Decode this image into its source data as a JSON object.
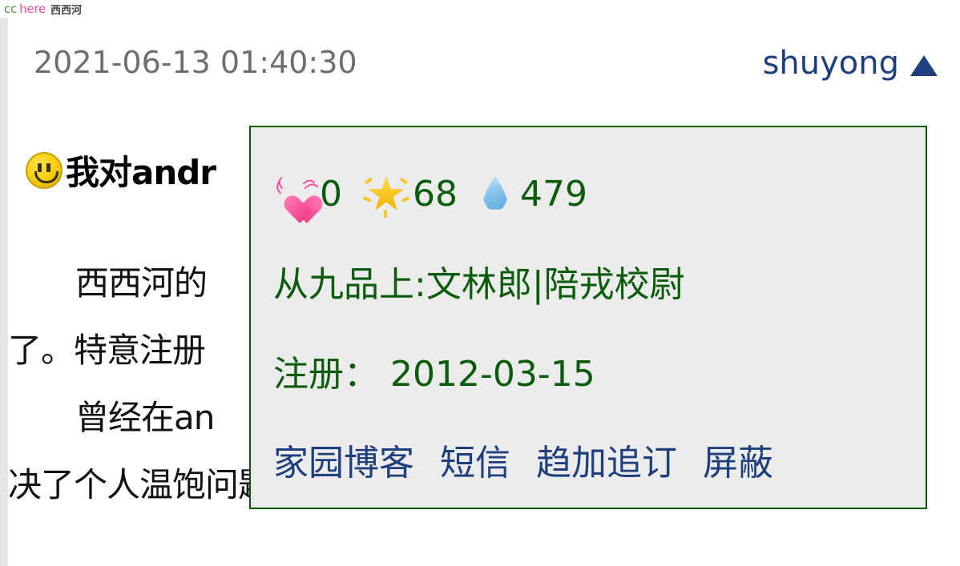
{
  "site": {
    "logo_cc": "cc",
    "logo_here": "here",
    "logo_cn": "西西河"
  },
  "post": {
    "timestamp": "2021-06-13 01:40:30",
    "author": "shuyong",
    "collapse_icon": "triangle-up-icon",
    "topic_icon": "smiley-icon",
    "title": "我对andr",
    "body_lines": [
      "西西河的",
      "了。特意注册",
      "曾经在an",
      "决了个人温饱问题。因此我对android开发还是有"
    ]
  },
  "user_card": {
    "stats": [
      {
        "icon": "beating-heart-icon",
        "label": "flowers",
        "value": "0"
      },
      {
        "icon": "glowing-star-icon",
        "label": "stars",
        "value": "68"
      },
      {
        "icon": "droplet-icon",
        "label": "drops",
        "value": "479"
      }
    ],
    "rank": "从九品上:文林郎|陪戎校尉",
    "register_label": "注册：",
    "register_date": "2012-03-15",
    "register_line": "注册：  2012-03-15",
    "links": [
      "家园博客",
      "短信",
      "趋加追订",
      "屏蔽"
    ]
  },
  "colors": {
    "logo_green": "#4a9b3f",
    "logo_pink": "#ef4f9b",
    "card_border": "#0a5c0a",
    "card_bg": "#ececec",
    "card_text_green": "#0a5c0a",
    "link_blue": "#1e3f7e",
    "meta_gray": "#6e6e6e"
  }
}
